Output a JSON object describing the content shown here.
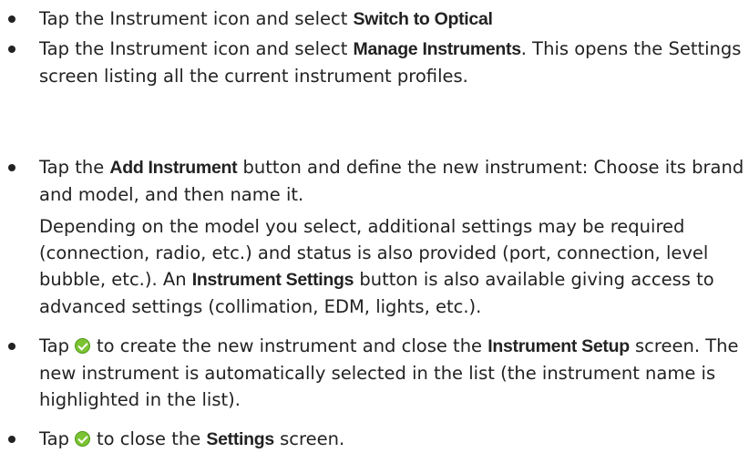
{
  "list_top": [
    {
      "before": "Tap the Instrument icon and select ",
      "bold": "Switch to Optical",
      "after": ""
    },
    {
      "before": "Tap the Instrument icon and select ",
      "bold": "Manage Instruments",
      "after": ". This opens the Settings screen listing all the current instrument profiles."
    }
  ],
  "list_bottom": {
    "item1": {
      "before": "Tap the ",
      "bold": "Add Instrument",
      "after": " button and define the new instrument: Choose its brand and model, and then name it.",
      "para_before": "Depending on the model you select, additional settings may be required (connection, radio, etc.) and status is also provided (port, connection, level bubble, etc.). An ",
      "para_bold": "Instrument Settings",
      "para_after": " button is also available giving access to advanced settings (collimation, EDM, lights, etc.)."
    },
    "item2": {
      "before": "Tap",
      "icon": "green-check-icon",
      "mid": "to create the new instrument and close the ",
      "bold": "Instrument Setup",
      "after": " screen. The new instrument is automatically selected in the list (the instrument name is highlighted in the list)."
    },
    "item3": {
      "before": "Tap",
      "icon": "green-check-icon",
      "mid": "to close the ",
      "bold": "Settings",
      "after": " screen."
    }
  }
}
